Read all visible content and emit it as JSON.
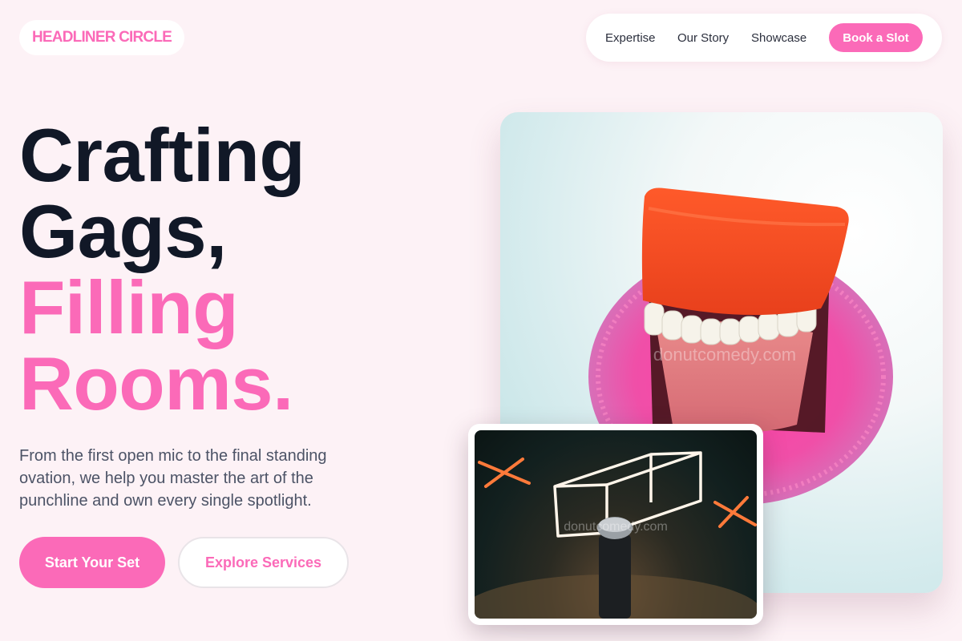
{
  "brand": {
    "name": "HEADLINER CIRCLE"
  },
  "nav": {
    "links": [
      "Expertise",
      "Our Story",
      "Showcase"
    ],
    "cta": "Book a Slot"
  },
  "hero": {
    "headline_dark": [
      "Crafting",
      "Gags,"
    ],
    "headline_pink": [
      "Filling",
      "Rooms."
    ],
    "lead": "From the first open mic to the final standing ovation, we help you master the art of the punchline and own every single spotlight.",
    "primary_cta": "Start Your Set",
    "secondary_cta": "Explore Services"
  },
  "images": {
    "main_watermark": "donutcomedy.com",
    "card_watermark": "donutcomedy.com"
  },
  "colors": {
    "accent": "#fb6ab8",
    "heading": "#111827",
    "background": "#fdf2f6",
    "body_text": "#4c5366"
  }
}
